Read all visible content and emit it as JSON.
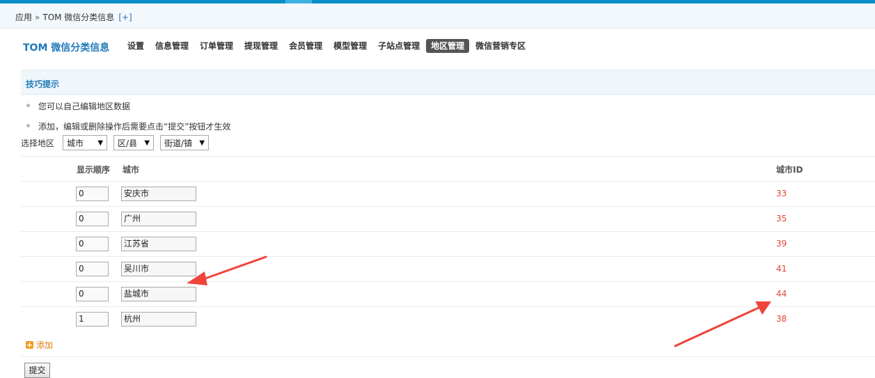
{
  "breadcrumb": {
    "root": "应用",
    "separator": "»",
    "current": "TOM 微信分类信息",
    "add": "[+]"
  },
  "plugin_title": "TOM 微信分类信息",
  "nav": [
    {
      "label": "设置",
      "active": false
    },
    {
      "label": "信息管理",
      "active": false
    },
    {
      "label": "订单管理",
      "active": false
    },
    {
      "label": "提现管理",
      "active": false
    },
    {
      "label": "会员管理",
      "active": false
    },
    {
      "label": "模型管理",
      "active": false
    },
    {
      "label": "子站点管理",
      "active": false
    },
    {
      "label": "地区管理",
      "active": true
    },
    {
      "label": "微信营销专区",
      "active": false
    }
  ],
  "tips": {
    "title": "技巧提示",
    "items": [
      "您可以自己编辑地区数据",
      "添加，编辑或删除操作后需要点击“提交”按钮才生效"
    ]
  },
  "filter": {
    "label": "选择地区",
    "selects": [
      {
        "value": "城市",
        "arrow": "▼"
      },
      {
        "value": "区/县",
        "arrow": "▼"
      },
      {
        "value": "街道/镇",
        "arrow": "▼"
      }
    ]
  },
  "table": {
    "headers": {
      "order": "显示顺序",
      "city": "城市",
      "id": "城市ID"
    },
    "rows": [
      {
        "order": "0",
        "city": "安庆市",
        "id": "33"
      },
      {
        "order": "0",
        "city": "广州",
        "id": "35"
      },
      {
        "order": "0",
        "city": "江苏省",
        "id": "39"
      },
      {
        "order": "0",
        "city": "吴川市",
        "id": "41"
      },
      {
        "order": "0",
        "city": "盐城市",
        "id": "44"
      },
      {
        "order": "1",
        "city": "杭州",
        "id": "38"
      }
    ]
  },
  "add_label": "添加",
  "add_icon": "+",
  "submit_label": "提交",
  "colors": {
    "accent": "#1f7ab8",
    "id_text": "#e0453b",
    "add_text": "#e07b0c",
    "annotation_arrow": "#f0433a"
  }
}
